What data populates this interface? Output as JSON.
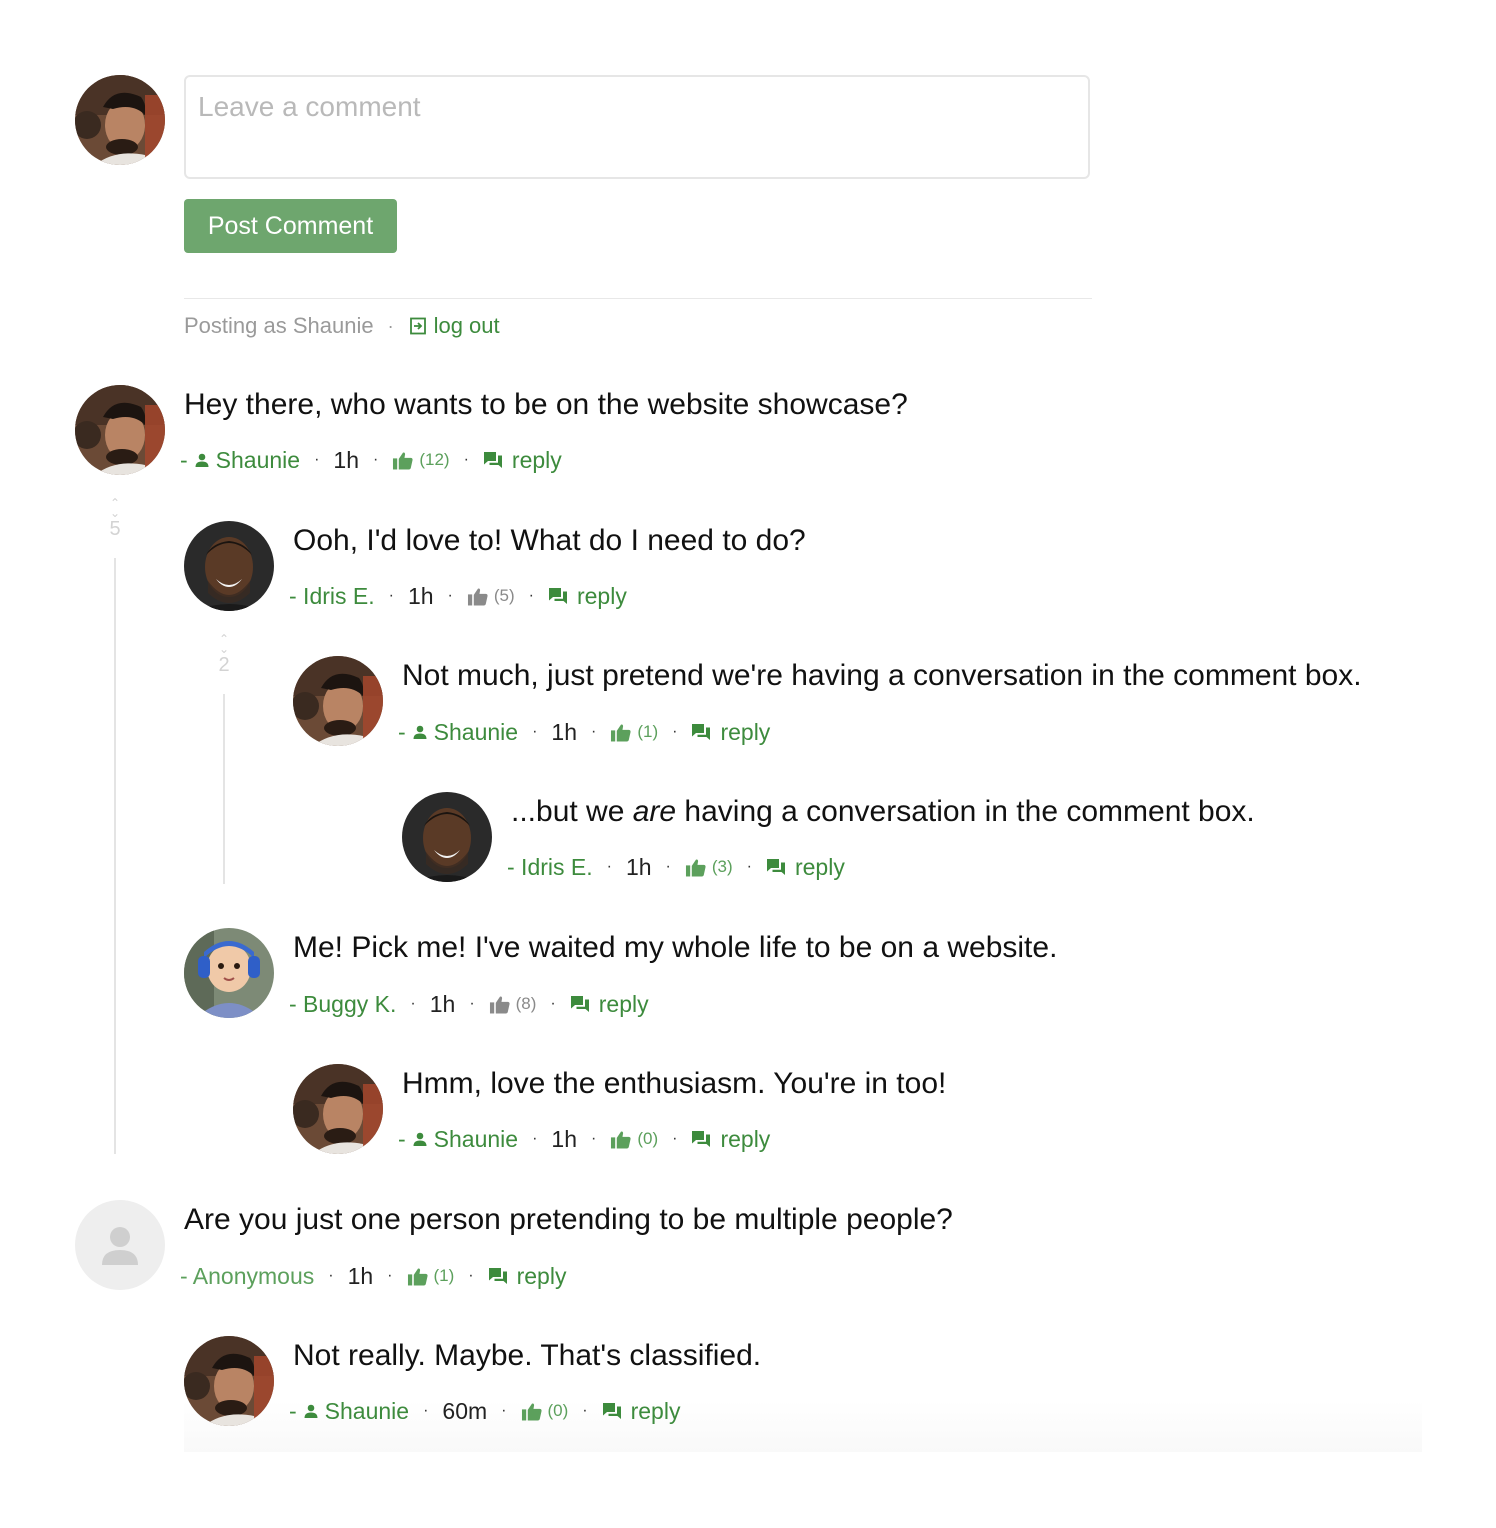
{
  "composer": {
    "placeholder": "Leave a comment",
    "post_label": "Post Comment",
    "posting_as": "Posting as Shaunie",
    "logout_label": "log out"
  },
  "comments": [
    {
      "text": "Hey there, who wants to be on the website showcase?",
      "author": "Shaunie",
      "time": "1h",
      "likes": "(12)",
      "reply": "reply"
    },
    {
      "text": "Ooh, I'd love to! What do I need to do?",
      "author": "- Idris E.",
      "time": "1h",
      "likes": "(5)",
      "reply": "reply"
    },
    {
      "text": "Not much, just pretend we're having a conversation in the comment box.",
      "author": "Shaunie",
      "time": "1h",
      "likes": "(1)",
      "reply": "reply"
    },
    {
      "text_before": "...but we ",
      "text_em": "are",
      "text_after": " having a conversation in the comment box.",
      "author": "- Idris E.",
      "time": "1h",
      "likes": "(3)",
      "reply": "reply"
    },
    {
      "text": "Me! Pick me! I've waited my whole life to be on a website.",
      "author": "- Buggy K.",
      "time": "1h",
      "likes": "(8)",
      "reply": "reply"
    },
    {
      "text": "Hmm, love the enthusiasm. You're in too!",
      "author": "Shaunie",
      "time": "1h",
      "likes": "(0)",
      "reply": "reply"
    },
    {
      "text": "Are you just one person pretending to be multiple people?",
      "author": "- Anonymous",
      "time": "1h",
      "likes": "(1)",
      "reply": "reply"
    },
    {
      "text": "Not really. Maybe. That's classified.",
      "author": "Shaunie",
      "time": "60m",
      "likes": "(0)",
      "reply": "reply"
    }
  ],
  "thread_counts": {
    "first": "5",
    "second": "2"
  },
  "colors": {
    "accent": "#3d8b3d",
    "button": "#6ea66e",
    "muted": "#9a9a9a"
  }
}
